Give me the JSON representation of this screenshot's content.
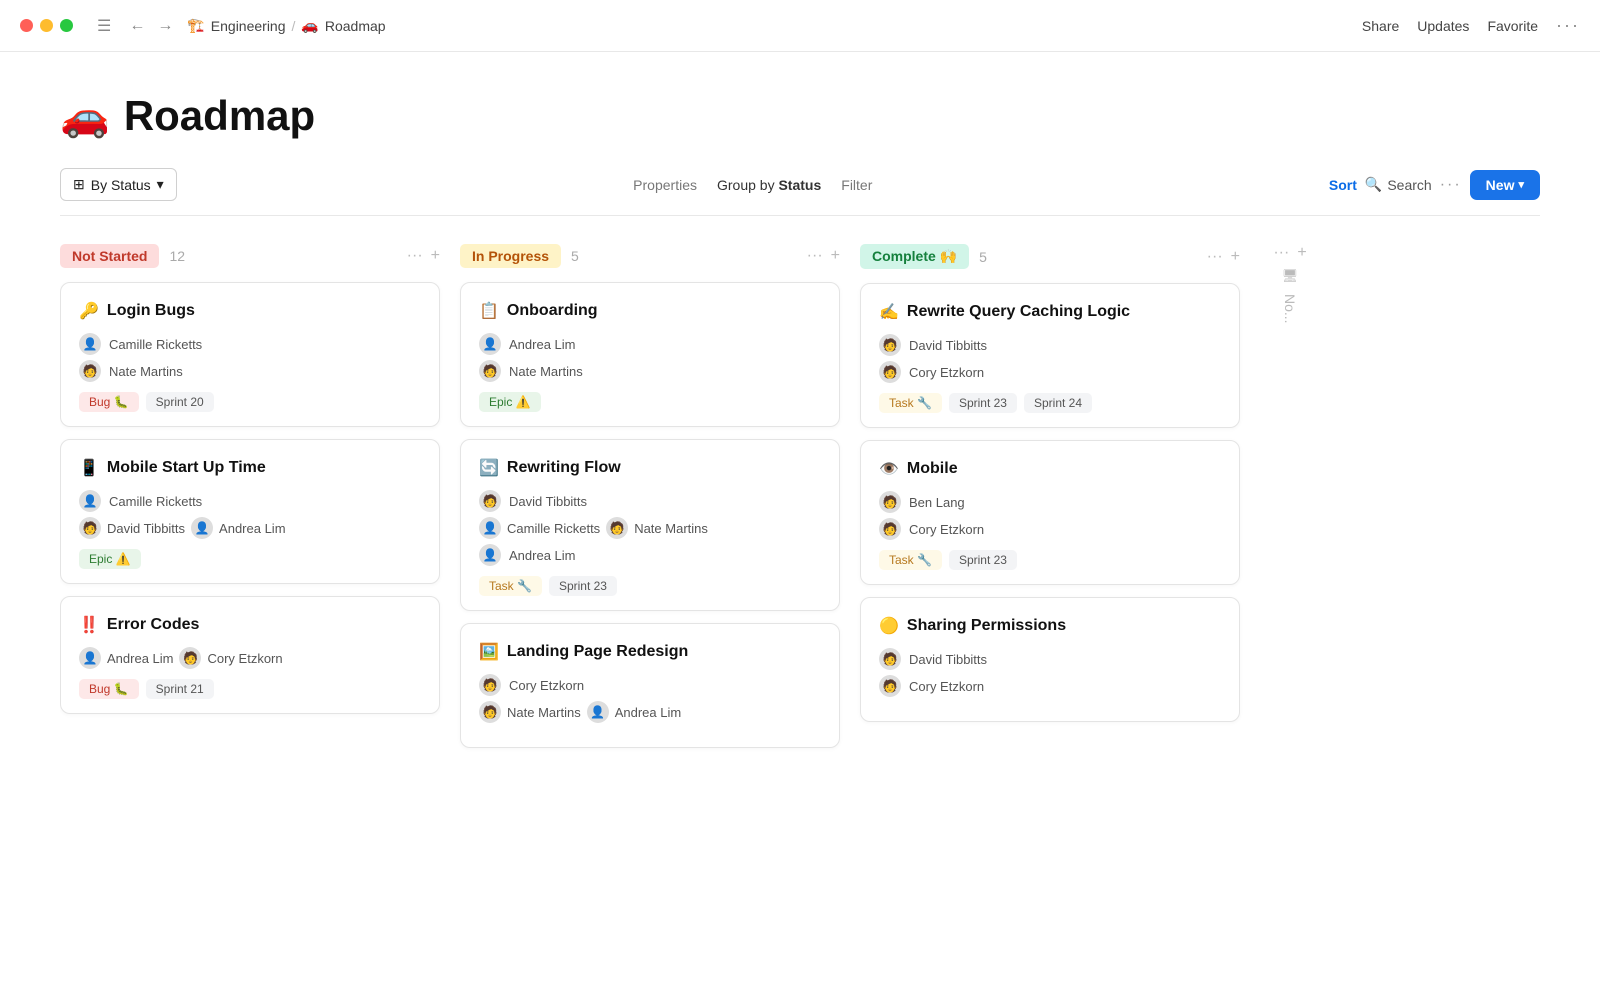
{
  "titlebar": {
    "breadcrumb_icon_engineering": "🏗️",
    "breadcrumb_engineering": "Engineering",
    "breadcrumb_sep": "/",
    "breadcrumb_icon_roadmap": "🚗",
    "breadcrumb_roadmap": "Roadmap",
    "share": "Share",
    "updates": "Updates",
    "favorite": "Favorite",
    "more": "···"
  },
  "page": {
    "icon": "🚗",
    "title": "Roadmap"
  },
  "toolbar": {
    "by_status": "By Status",
    "properties": "Properties",
    "group_by": "Group by",
    "group_by_bold": "Status",
    "filter": "Filter",
    "sort": "Sort",
    "search": "Search",
    "more": "···",
    "new": "New",
    "chevron": "▾"
  },
  "columns": [
    {
      "id": "not-started",
      "label": "Not Started",
      "badge_class": "status-not-started",
      "count": 12,
      "cards": [
        {
          "emoji": "🔑",
          "title": "Login Bugs",
          "members": [
            {
              "name": "Camille Ricketts",
              "avatar": "👤"
            },
            {
              "name": "Nate Martins",
              "avatar": "🧑"
            }
          ],
          "tags": [
            {
              "label": "Bug 🐛",
              "class": "tag-bug"
            },
            {
              "label": "Sprint 20",
              "class": "tag-sprint"
            }
          ]
        },
        {
          "emoji": "📱",
          "title": "Mobile Start Up Time",
          "members": [
            {
              "name": "Camille Ricketts",
              "avatar": "👤"
            },
            {
              "name": "David Tibbitts",
              "avatar": "🧑",
              "extra": "Andrea Lim",
              "extra_avatar": "👤"
            }
          ],
          "tags": [
            {
              "label": "Epic ⚠️",
              "class": "tag-epic"
            }
          ]
        },
        {
          "emoji": "‼️",
          "title": "Error Codes",
          "members": [
            {
              "name": "Andrea Lim",
              "avatar": "👤",
              "extra": "Cory Etzkorn",
              "extra_avatar": "🧑"
            }
          ],
          "tags": [
            {
              "label": "Bug 🐛",
              "class": "tag-bug"
            },
            {
              "label": "Sprint 21",
              "class": "tag-sprint"
            }
          ]
        }
      ]
    },
    {
      "id": "in-progress",
      "label": "In Progress",
      "badge_class": "status-in-progress",
      "count": 5,
      "cards": [
        {
          "emoji": "📋",
          "title": "Onboarding",
          "members": [
            {
              "name": "Andrea Lim",
              "avatar": "👤"
            },
            {
              "name": "Nate Martins",
              "avatar": "🧑"
            }
          ],
          "tags": [
            {
              "label": "Epic ⚠️",
              "class": "tag-epic"
            }
          ]
        },
        {
          "emoji": "🔄",
          "title": "Rewriting Flow",
          "members": [
            {
              "name": "David Tibbitts",
              "avatar": "🧑"
            },
            {
              "name": "Camille Ricketts",
              "avatar": "👤",
              "extra": "Nate Martins",
              "extra_avatar": "🧑"
            },
            {
              "name": "Andrea Lim",
              "avatar": "👤"
            }
          ],
          "tags": [
            {
              "label": "Task 🔧",
              "class": "tag-task"
            },
            {
              "label": "Sprint 23",
              "class": "tag-sprint"
            }
          ]
        },
        {
          "emoji": "🖼️",
          "title": "Landing Page Redesign",
          "members": [
            {
              "name": "Cory Etzkorn",
              "avatar": "🧑"
            },
            {
              "name": "Nate Martins",
              "avatar": "🧑",
              "extra": "Andrea Lim",
              "extra_avatar": "👤"
            }
          ],
          "tags": []
        }
      ]
    },
    {
      "id": "complete",
      "label": "Complete 🙌",
      "badge_class": "status-complete",
      "count": 5,
      "cards": [
        {
          "emoji": "✍️",
          "title": "Rewrite Query Caching Logic",
          "members": [
            {
              "name": "David Tibbitts",
              "avatar": "🧑"
            },
            {
              "name": "Cory Etzkorn",
              "avatar": "🧑"
            }
          ],
          "tags": [
            {
              "label": "Task 🔧",
              "class": "tag-task"
            },
            {
              "label": "Sprint 23",
              "class": "tag-sprint"
            },
            {
              "label": "Sprint 24",
              "class": "tag-sprint"
            }
          ]
        },
        {
          "emoji": "👁️",
          "title": "Mobile",
          "members": [
            {
              "name": "Ben Lang",
              "avatar": "🧑"
            },
            {
              "name": "Cory Etzkorn",
              "avatar": "🧑"
            }
          ],
          "tags": [
            {
              "label": "Task 🔧",
              "class": "tag-task"
            },
            {
              "label": "Sprint 23",
              "class": "tag-sprint"
            }
          ]
        },
        {
          "emoji": "🟡",
          "title": "Sharing Permissions",
          "members": [
            {
              "name": "David Tibbitts",
              "avatar": "🧑"
            },
            {
              "name": "Cory Etzkorn",
              "avatar": "🧑"
            }
          ],
          "tags": []
        }
      ]
    }
  ],
  "hidden_column": {
    "label": "No..."
  }
}
